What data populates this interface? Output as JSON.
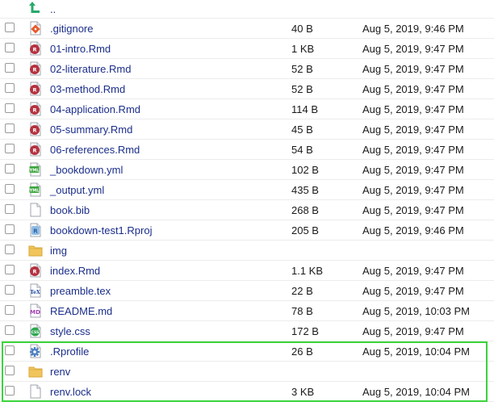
{
  "file_list": {
    "parent": {
      "label": "..",
      "icon": "go-up-arrow-icon"
    },
    "files": [
      {
        "name": ".gitignore",
        "size": "40 B",
        "modified": "Aug 5, 2019, 9:46 PM",
        "icon": "git-file-icon"
      },
      {
        "name": "01-intro.Rmd",
        "size": "1 KB",
        "modified": "Aug 5, 2019, 9:47 PM",
        "icon": "rmarkdown-file-icon"
      },
      {
        "name": "02-literature.Rmd",
        "size": "52 B",
        "modified": "Aug 5, 2019, 9:47 PM",
        "icon": "rmarkdown-file-icon"
      },
      {
        "name": "03-method.Rmd",
        "size": "52 B",
        "modified": "Aug 5, 2019, 9:47 PM",
        "icon": "rmarkdown-file-icon"
      },
      {
        "name": "04-application.Rmd",
        "size": "114 B",
        "modified": "Aug 5, 2019, 9:47 PM",
        "icon": "rmarkdown-file-icon"
      },
      {
        "name": "05-summary.Rmd",
        "size": "45 B",
        "modified": "Aug 5, 2019, 9:47 PM",
        "icon": "rmarkdown-file-icon"
      },
      {
        "name": "06-references.Rmd",
        "size": "54 B",
        "modified": "Aug 5, 2019, 9:47 PM",
        "icon": "rmarkdown-file-icon"
      },
      {
        "name": "_bookdown.yml",
        "size": "102 B",
        "modified": "Aug 5, 2019, 9:47 PM",
        "icon": "yaml-file-icon"
      },
      {
        "name": "_output.yml",
        "size": "435 B",
        "modified": "Aug 5, 2019, 9:47 PM",
        "icon": "yaml-file-icon"
      },
      {
        "name": "book.bib",
        "size": "268 B",
        "modified": "Aug 5, 2019, 9:47 PM",
        "icon": "blank-file-icon"
      },
      {
        "name": "bookdown-test1.Rproj",
        "size": "205 B",
        "modified": "Aug 5, 2019, 9:46 PM",
        "icon": "rproject-file-icon"
      },
      {
        "name": "img",
        "size": "",
        "modified": "",
        "icon": "folder-icon"
      },
      {
        "name": "index.Rmd",
        "size": "1.1 KB",
        "modified": "Aug 5, 2019, 9:47 PM",
        "icon": "rmarkdown-file-icon"
      },
      {
        "name": "preamble.tex",
        "size": "22 B",
        "modified": "Aug 5, 2019, 9:47 PM",
        "icon": "tex-file-icon"
      },
      {
        "name": "README.md",
        "size": "78 B",
        "modified": "Aug 5, 2019, 10:03 PM",
        "icon": "markdown-file-icon"
      },
      {
        "name": "style.css",
        "size": "172 B",
        "modified": "Aug 5, 2019, 9:47 PM",
        "icon": "css-file-icon"
      },
      {
        "name": ".Rprofile",
        "size": "26 B",
        "modified": "Aug 5, 2019, 10:04 PM",
        "icon": "rprofile-gear-icon"
      },
      {
        "name": "renv",
        "size": "",
        "modified": "",
        "icon": "folder-icon"
      },
      {
        "name": "renv.lock",
        "size": "3 KB",
        "modified": "Aug 5, 2019, 10:04 PM",
        "icon": "blank-file-icon"
      }
    ]
  },
  "colors": {
    "link": "#1b2e8a",
    "highlight_border": "#3bd43b",
    "folder": "#f2c55c",
    "rmarkdown_badge": "#75aadb",
    "yaml_badge": "#3aa63a"
  }
}
